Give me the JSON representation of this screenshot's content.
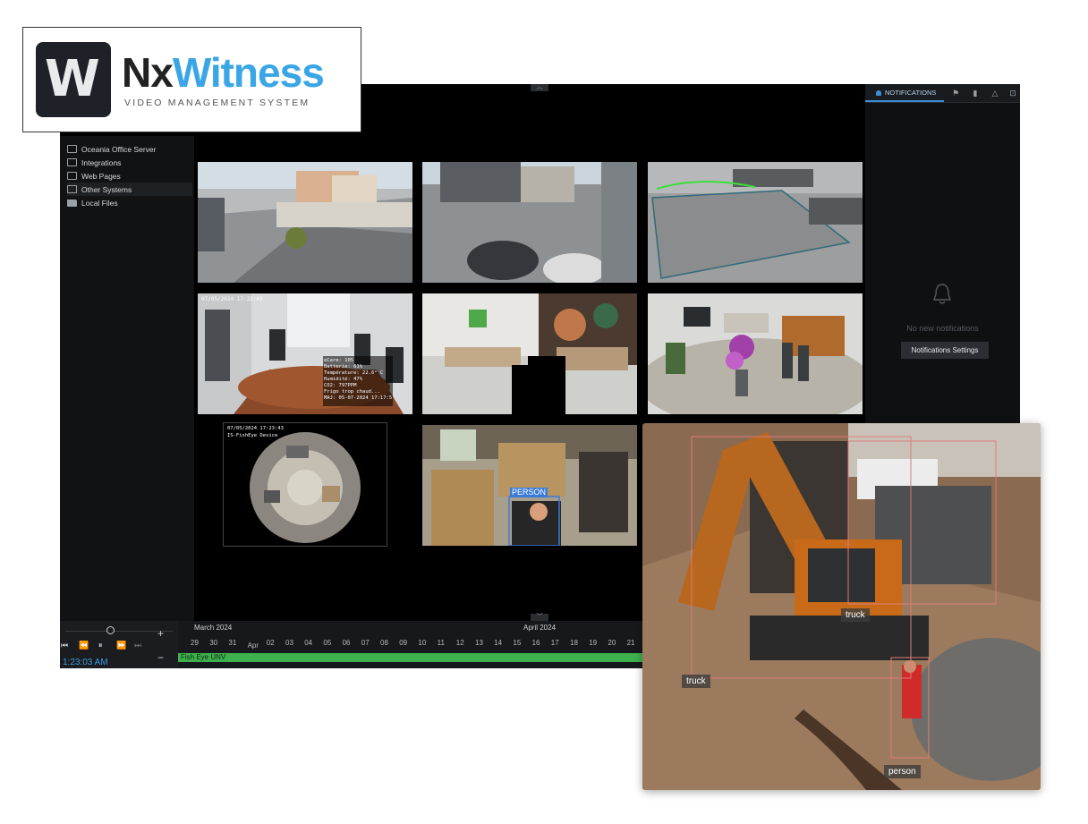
{
  "brand": {
    "mark_letter": "W",
    "name_part1": "Nx",
    "name_part2": "Witness",
    "subtitle": "VIDEO MANAGEMENT SYSTEM"
  },
  "sidebar": {
    "items": [
      {
        "label": "Oceania Office Server",
        "icon": "server-icon"
      },
      {
        "label": "Integrations",
        "icon": "integrations-icon"
      },
      {
        "label": "Web Pages",
        "icon": "web-page-icon"
      },
      {
        "label": "Other Systems",
        "icon": "systems-icon"
      },
      {
        "label": "Local Files",
        "icon": "folder-icon"
      }
    ]
  },
  "camera_grid": {
    "tiles": [
      {
        "name": "street-camera"
      },
      {
        "name": "parking-camera"
      },
      {
        "name": "analytics-zone-camera"
      },
      {
        "name": "meeting-room-camera",
        "timestamp": "07/05/2024 17:23:43",
        "osd": [
          "eCare: 105",
          "Batterie: 61%",
          "Température: 22.6° C",
          "Humidité: 47%",
          "CO2: 797PPM",
          "Frigo trop chaud...",
          "MAJ: 05-07-2024 17:17:5"
        ]
      },
      {
        "name": "office-lobby-camera"
      },
      {
        "name": "lounge-camera"
      },
      {
        "name": "fisheye-camera",
        "timestamp": "07/05/2024 17:23:43",
        "subtitle": "IS-FishEye Device"
      },
      {
        "name": "warehouse-camera",
        "detection_label": "PERSON"
      }
    ]
  },
  "notifications": {
    "tab_label": "NOTIFICATIONS",
    "empty_text": "No new notifications",
    "settings_button": "Notifications Settings"
  },
  "timeline": {
    "months": [
      "March 2024",
      "April 2024"
    ],
    "days": [
      "29",
      "30",
      "31",
      "Apr",
      "02",
      "03",
      "04",
      "05",
      "06",
      "07",
      "08",
      "09",
      "10",
      "11",
      "12",
      "13",
      "14",
      "15",
      "16",
      "17",
      "18",
      "19",
      "20",
      "21"
    ],
    "current_time": "1:23:03 AM",
    "camera_label": "Fish Eye UNV",
    "zoom_in": "+",
    "zoom_out": "−"
  },
  "detection_view": {
    "labels": [
      "truck",
      "truck",
      "person"
    ]
  },
  "colors": {
    "accent_blue": "#3a9de0",
    "timeline_green": "#3fb04e",
    "app_bg": "#000000"
  }
}
